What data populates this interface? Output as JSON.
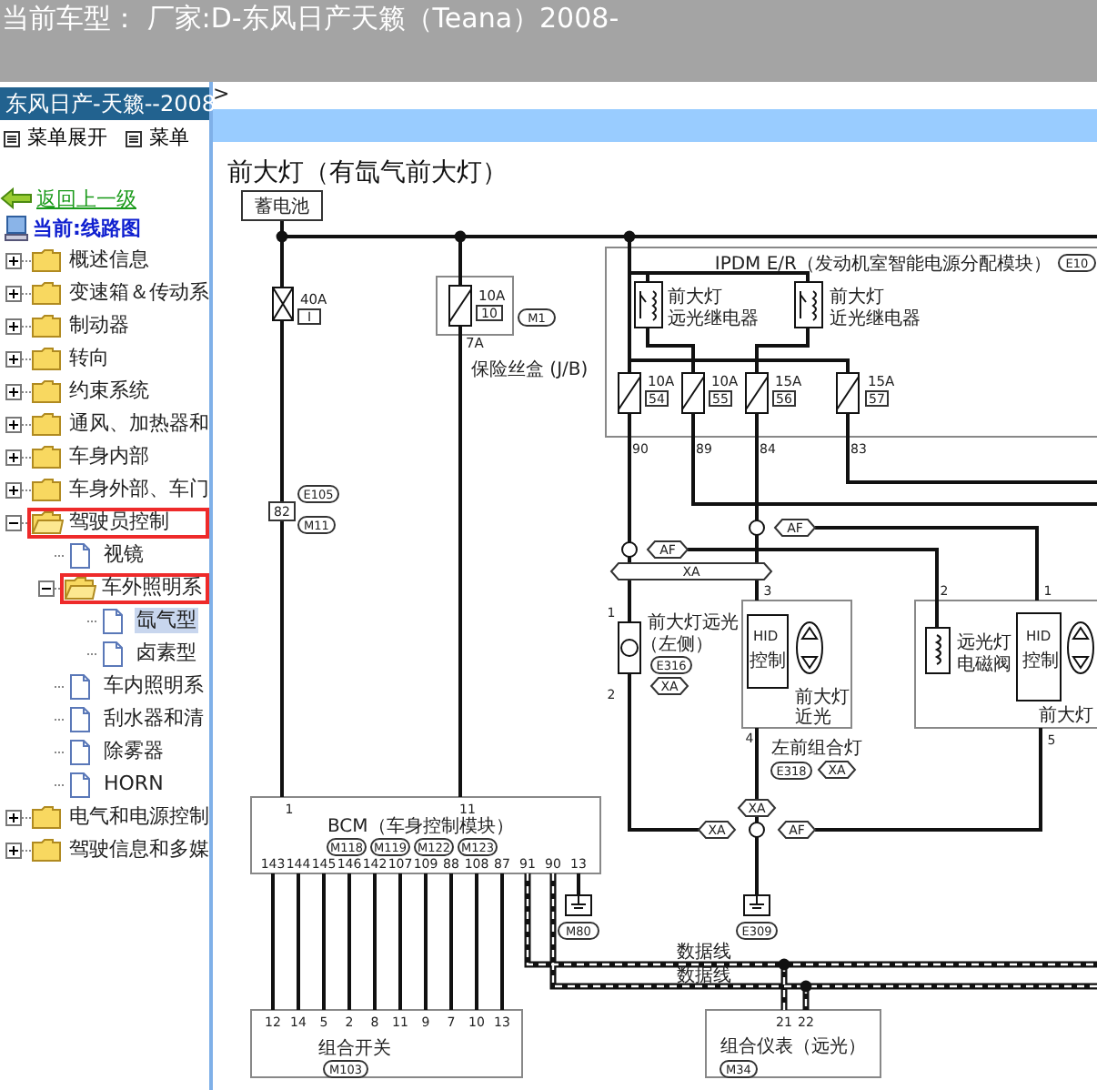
{
  "header": {
    "text": "当前车型：  厂家:D-东风日产天籁（Teana）2008-"
  },
  "sidebar": {
    "title": "东风日产-天籁--2008",
    "menu": [
      {
        "label": "菜单展开"
      },
      {
        "label": "菜单"
      }
    ],
    "back_link": "返回上一级",
    "current": "当前:线路图",
    "tree": [
      {
        "label": "概述信息",
        "kind": "folder",
        "expanded": false,
        "highlighted": false,
        "selected": false
      },
      {
        "label": "变速箱＆传动系",
        "kind": "folder",
        "expanded": false,
        "highlighted": false,
        "selected": false
      },
      {
        "label": "制动器",
        "kind": "folder",
        "expanded": false,
        "highlighted": false,
        "selected": false
      },
      {
        "label": "转向",
        "kind": "folder",
        "expanded": false,
        "highlighted": false,
        "selected": false
      },
      {
        "label": "约束系统",
        "kind": "folder",
        "expanded": false,
        "highlighted": false,
        "selected": false
      },
      {
        "label": "通风、加热器和",
        "kind": "folder",
        "expanded": false,
        "highlighted": false,
        "selected": false
      },
      {
        "label": "车身内部",
        "kind": "folder",
        "expanded": false,
        "highlighted": false,
        "selected": false
      },
      {
        "label": "车身外部、车门",
        "kind": "folder",
        "expanded": false,
        "highlighted": false,
        "selected": false
      },
      {
        "label": "驾驶员控制",
        "kind": "folder",
        "expanded": true,
        "highlighted": true,
        "selected": false,
        "children": [
          {
            "label": "视镜",
            "kind": "page",
            "highlighted": false,
            "selected": false
          },
          {
            "label": "车外照明系",
            "kind": "folder",
            "expanded": true,
            "highlighted": true,
            "selected": false,
            "children": [
              {
                "label": "氙气型",
                "kind": "page",
                "highlighted": false,
                "selected": true
              },
              {
                "label": "卤素型",
                "kind": "page",
                "highlighted": false,
                "selected": false
              }
            ]
          },
          {
            "label": "车内照明系",
            "kind": "page",
            "highlighted": false,
            "selected": false
          },
          {
            "label": "刮水器和清",
            "kind": "page",
            "highlighted": false,
            "selected": false
          },
          {
            "label": "除雾器",
            "kind": "page",
            "highlighted": false,
            "selected": false
          },
          {
            "label": "HORN",
            "kind": "page",
            "highlighted": false,
            "selected": false
          }
        ]
      },
      {
        "label": "电气和电源控制",
        "kind": "folder",
        "expanded": false,
        "highlighted": false,
        "selected": false
      },
      {
        "label": "驾驶信息和多媒",
        "kind": "folder",
        "expanded": false,
        "highlighted": false,
        "selected": false
      }
    ]
  },
  "panel": {
    "nav_arrow": ">"
  },
  "diagram": {
    "title": "前大灯（有氙气前大灯）",
    "labels": [
      {
        "kind": "box",
        "text": "蓄电池"
      },
      {
        "kind": "small",
        "text": "40A"
      },
      {
        "kind": "box",
        "text": "I"
      },
      {
        "kind": "small",
        "text": "10A"
      },
      {
        "kind": "box",
        "text": "10"
      },
      {
        "kind": "oval",
        "text": "M1"
      },
      {
        "kind": "small",
        "text": "7A"
      },
      {
        "kind": "text",
        "text": "保险丝盒 (J/B)"
      },
      {
        "kind": "oval",
        "text": "E105"
      },
      {
        "kind": "box",
        "text": "82"
      },
      {
        "kind": "oval",
        "text": "M11"
      },
      {
        "kind": "text",
        "text": "IPDM E/R（发动机室智能电源分配模块）"
      },
      {
        "kind": "oval",
        "text": "E10"
      },
      {
        "kind": "text",
        "text": "前大灯"
      },
      {
        "kind": "text",
        "text": "远光继电器"
      },
      {
        "kind": "text",
        "text": "前大灯"
      },
      {
        "kind": "text",
        "text": "近光继电器"
      },
      {
        "kind": "small",
        "text": "10A"
      },
      {
        "kind": "box",
        "text": "54"
      },
      {
        "kind": "small",
        "text": "10A"
      },
      {
        "kind": "box",
        "text": "55"
      },
      {
        "kind": "small",
        "text": "15A"
      },
      {
        "kind": "box",
        "text": "56"
      },
      {
        "kind": "small",
        "text": "15A"
      },
      {
        "kind": "box",
        "text": "57"
      },
      {
        "kind": "pin",
        "text": "90"
      },
      {
        "kind": "pin",
        "text": "89"
      },
      {
        "kind": "pin",
        "text": "84"
      },
      {
        "kind": "pin",
        "text": "83"
      },
      {
        "kind": "tag",
        "text": "AF"
      },
      {
        "kind": "tag",
        "text": "AF"
      },
      {
        "kind": "tag",
        "text": "XA"
      },
      {
        "kind": "pin",
        "text": "3"
      },
      {
        "kind": "pin",
        "text": "2"
      },
      {
        "kind": "pin",
        "text": "1"
      },
      {
        "kind": "pin",
        "text": "1"
      },
      {
        "kind": "text",
        "text": "前大灯远光"
      },
      {
        "kind": "text",
        "text": "（左侧）"
      },
      {
        "kind": "oval",
        "text": "E316"
      },
      {
        "kind": "tag",
        "text": "XA"
      },
      {
        "kind": "pin",
        "text": "2"
      },
      {
        "kind": "small",
        "text": "HID"
      },
      {
        "kind": "text",
        "text": "控制"
      },
      {
        "kind": "text",
        "text": "前大灯"
      },
      {
        "kind": "text",
        "text": "近光"
      },
      {
        "kind": "text",
        "text": "左前组合灯"
      },
      {
        "kind": "oval",
        "text": "E318"
      },
      {
        "kind": "tag",
        "text": "XA"
      },
      {
        "kind": "pin",
        "text": "4"
      },
      {
        "kind": "text",
        "text": "远光灯"
      },
      {
        "kind": "text",
        "text": "电磁阀"
      },
      {
        "kind": "small",
        "text": "HID"
      },
      {
        "kind": "text",
        "text": "控制"
      },
      {
        "kind": "text",
        "text": "前大灯"
      },
      {
        "kind": "pin",
        "text": "5"
      },
      {
        "kind": "tag",
        "text": "XA"
      },
      {
        "kind": "tag",
        "text": "XA"
      },
      {
        "kind": "tag",
        "text": "AF"
      },
      {
        "kind": "oval",
        "text": "E309"
      },
      {
        "kind": "pin",
        "text": "1"
      },
      {
        "kind": "pin",
        "text": "11"
      },
      {
        "kind": "text",
        "text": "BCM（车身控制模块）"
      },
      {
        "kind": "oval",
        "text": "M118"
      },
      {
        "kind": "oval",
        "text": "M119"
      },
      {
        "kind": "oval",
        "text": "M122"
      },
      {
        "kind": "oval",
        "text": "M123"
      },
      {
        "kind": "pin",
        "text": "143"
      },
      {
        "kind": "pin",
        "text": "144"
      },
      {
        "kind": "pin",
        "text": "145"
      },
      {
        "kind": "pin",
        "text": "146"
      },
      {
        "kind": "pin",
        "text": "142"
      },
      {
        "kind": "pin",
        "text": "107"
      },
      {
        "kind": "pin",
        "text": "109"
      },
      {
        "kind": "pin",
        "text": "88"
      },
      {
        "kind": "pin",
        "text": "108"
      },
      {
        "kind": "pin",
        "text": "87"
      },
      {
        "kind": "pin",
        "text": "91"
      },
      {
        "kind": "pin",
        "text": "90"
      },
      {
        "kind": "pin",
        "text": "13"
      },
      {
        "kind": "oval",
        "text": "M80"
      },
      {
        "kind": "pin",
        "text": "12"
      },
      {
        "kind": "pin",
        "text": "14"
      },
      {
        "kind": "pin",
        "text": "5"
      },
      {
        "kind": "pin",
        "text": "2"
      },
      {
        "kind": "pin",
        "text": "8"
      },
      {
        "kind": "pin",
        "text": "11"
      },
      {
        "kind": "pin",
        "text": "9"
      },
      {
        "kind": "pin",
        "text": "7"
      },
      {
        "kind": "pin",
        "text": "10"
      },
      {
        "kind": "pin",
        "text": "13"
      },
      {
        "kind": "text",
        "text": "组合开关"
      },
      {
        "kind": "oval",
        "text": "M103"
      },
      {
        "kind": "text",
        "text": "数据线"
      },
      {
        "kind": "text",
        "text": "数据线"
      },
      {
        "kind": "pin",
        "text": "21"
      },
      {
        "kind": "pin",
        "text": "22"
      },
      {
        "kind": "text",
        "text": "组合仪表（远光）"
      },
      {
        "kind": "oval",
        "text": "M34"
      }
    ]
  }
}
